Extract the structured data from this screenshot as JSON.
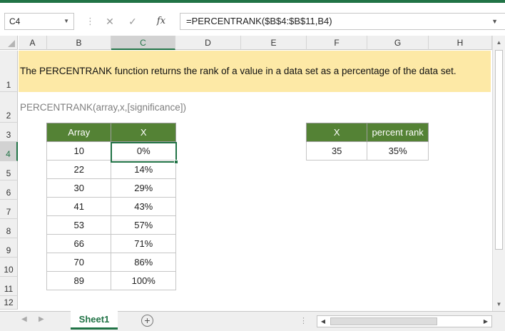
{
  "formula_bar": {
    "name_box": "C4",
    "cancel_icon": "✕",
    "enter_icon": "✓",
    "fx_label": "fx",
    "formula": "=PERCENTRANK($B$4:$B$11,B4)"
  },
  "columns": [
    "A",
    "B",
    "C",
    "D",
    "E",
    "F",
    "G",
    "H"
  ],
  "rows": [
    "1",
    "2",
    "3",
    "4",
    "5",
    "6",
    "7",
    "8",
    "9",
    "10",
    "11",
    "12"
  ],
  "selected_cell": "C4",
  "banner_text": "The PERCENTRANK function returns the rank of a value in a data set as a percentage of the data set.",
  "syntax_text": "PERCENTRANK(array,x,[significance])",
  "data_table": {
    "headers": [
      "Array",
      "X"
    ],
    "rows": [
      [
        "10",
        "0%"
      ],
      [
        "22",
        "14%"
      ],
      [
        "30",
        "29%"
      ],
      [
        "41",
        "43%"
      ],
      [
        "53",
        "57%"
      ],
      [
        "66",
        "71%"
      ],
      [
        "70",
        "86%"
      ],
      [
        "89",
        "100%"
      ]
    ]
  },
  "result_table": {
    "headers": [
      "X",
      "percent rank"
    ],
    "row": [
      "35",
      "35%"
    ]
  },
  "sheet_tabs": {
    "active": "Sheet1",
    "add_icon": "+",
    "ellipsis": "⋮"
  },
  "colors": {
    "header_green": "#548235",
    "banner_yellow": "#fde9a6",
    "accent": "#217346"
  }
}
